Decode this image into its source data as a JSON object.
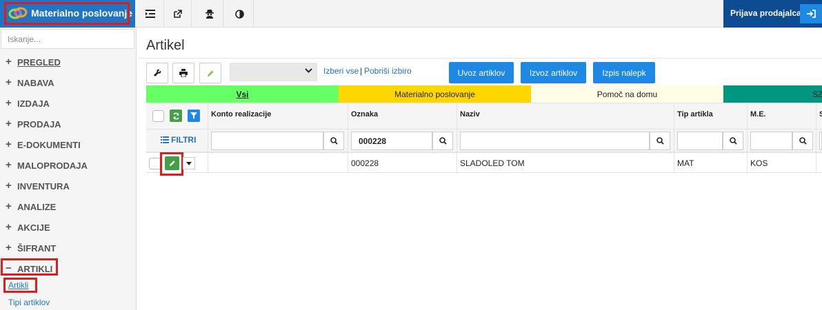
{
  "header": {
    "app_title": "Materialno poslovanje",
    "toolbar_icons": [
      "list-indent-icon",
      "external-link-icon",
      "user-secret-icon",
      "contrast-icon"
    ],
    "login_label": "Prijava prodajalca"
  },
  "sidebar": {
    "search_placeholder": "Iskanje...",
    "items": [
      {
        "icon": "+",
        "label": "PREGLED"
      },
      {
        "icon": "+",
        "label": "NABAVA"
      },
      {
        "icon": "+",
        "label": "IZDAJA"
      },
      {
        "icon": "+",
        "label": "PRODAJA"
      },
      {
        "icon": "+",
        "label": "E-DOKUMENTI"
      },
      {
        "icon": "+",
        "label": "MALOPRODAJA"
      },
      {
        "icon": "+",
        "label": "INVENTURA"
      },
      {
        "icon": "+",
        "label": "ANALIZE"
      },
      {
        "icon": "+",
        "label": "AKCIJE"
      },
      {
        "icon": "+",
        "label": "ŠIFRANT"
      },
      {
        "icon": "−",
        "label": "ARTIKLI"
      }
    ],
    "subitems": [
      "Artikli",
      "Tipi artiklov"
    ]
  },
  "page": {
    "title": "Artikel",
    "select_all": "Izberi vse",
    "separator": "|",
    "clear_selection": "Pobriši izbiro",
    "btn_import": "Uvoz artiklov",
    "btn_export": "Izvoz artiklov",
    "btn_labels": "Izpis nalepk"
  },
  "tabs": [
    {
      "label": "Vsi",
      "color": "#66ff66"
    },
    {
      "label": "Materialno poslovanje",
      "color": "#ffd700"
    },
    {
      "label": "Pomoč na domu",
      "color": "#fffde6"
    },
    {
      "label": "SZ",
      "color": "#00967f"
    }
  ],
  "grid": {
    "filter_label": "FILTRI",
    "columns": [
      "Konto realizacije",
      "Oznaka",
      "Naziv",
      "Tip artikla",
      "M.E.",
      "S"
    ],
    "filters": {
      "oznaka": "000228"
    },
    "rows": [
      {
        "konto": "",
        "oznaka": "000228",
        "naziv": "SLADOLED TOM",
        "tip": "MAT",
        "me": "KOS"
      }
    ]
  },
  "colors": {
    "brand": "#1f75c4",
    "login": "#0d4c92",
    "primary_button": "#1e88e5",
    "highlight": "#e01b1b",
    "edit_button": "#43a047"
  }
}
